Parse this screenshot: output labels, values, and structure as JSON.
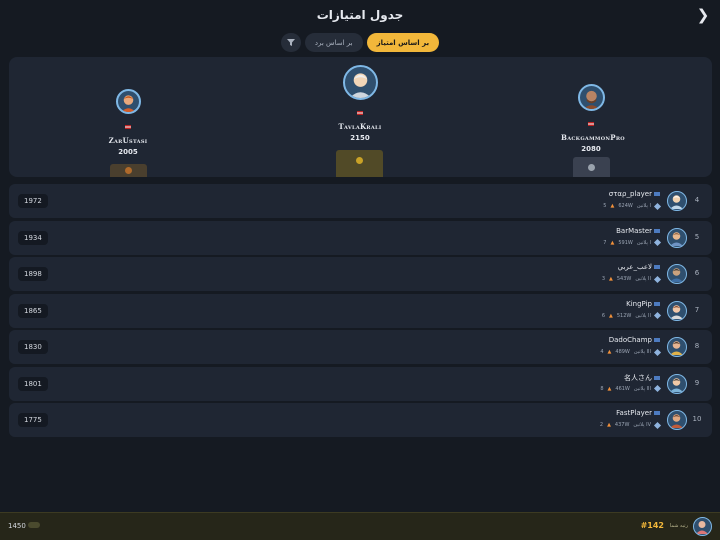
{
  "header": {
    "title": "جدول امتیازات",
    "back_icon": "chevron-right-icon"
  },
  "tabs": [
    {
      "label": "بر اساس امتیاز",
      "active": true
    },
    {
      "label": "بر اساس برد",
      "active": false
    }
  ],
  "filter_icon": "filter-icon",
  "podium": [
    {
      "place": 2,
      "name": "ZarUstasi",
      "score": "2005",
      "badge": "الماس"
    },
    {
      "place": 1,
      "name": "TavlaKrali",
      "score": "2150",
      "badge": "الماس"
    },
    {
      "place": 3,
      "name": "BackgammonPro",
      "score": "2080",
      "badge": "الماس"
    }
  ],
  "rows": [
    {
      "rank": "4",
      "name": "σταρ_player",
      "tier": "پلاتین I",
      "wins": "624W",
      "streak": "5",
      "score": "1972"
    },
    {
      "rank": "5",
      "name": "BarMaster",
      "tier": "پلاتین I",
      "wins": "591W",
      "streak": "7",
      "score": "1934"
    },
    {
      "rank": "6",
      "name": "لاعب_عربي",
      "tier": "پلاتین II",
      "wins": "543W",
      "streak": "3",
      "score": "1898"
    },
    {
      "rank": "7",
      "name": "KingPip",
      "tier": "پلاتین II",
      "wins": "512W",
      "streak": "6",
      "score": "1865"
    },
    {
      "rank": "8",
      "name": "DadoChamp",
      "tier": "پلاتین III",
      "wins": "489W",
      "streak": "4",
      "score": "1830"
    },
    {
      "rank": "9",
      "name": "名人さん",
      "tier": "پلاتین III",
      "wins": "461W",
      "streak": "8",
      "score": "1801"
    },
    {
      "rank": "10",
      "name": "FastPlayer",
      "tier": "پلاتین IV",
      "wins": "437W",
      "streak": "2",
      "score": "1775"
    }
  ],
  "footer": {
    "label": "رتبه شما",
    "rank": "#142",
    "score": "1450"
  },
  "colors": {
    "accent": "#f2b73a",
    "gold": "#c9a227",
    "silver": "#9aa3ad",
    "bronze": "#b06a2b"
  }
}
